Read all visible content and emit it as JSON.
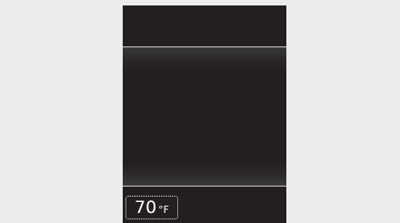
{
  "climate_display": {
    "temperature": {
      "value": "70",
      "unit": "°F"
    }
  }
}
